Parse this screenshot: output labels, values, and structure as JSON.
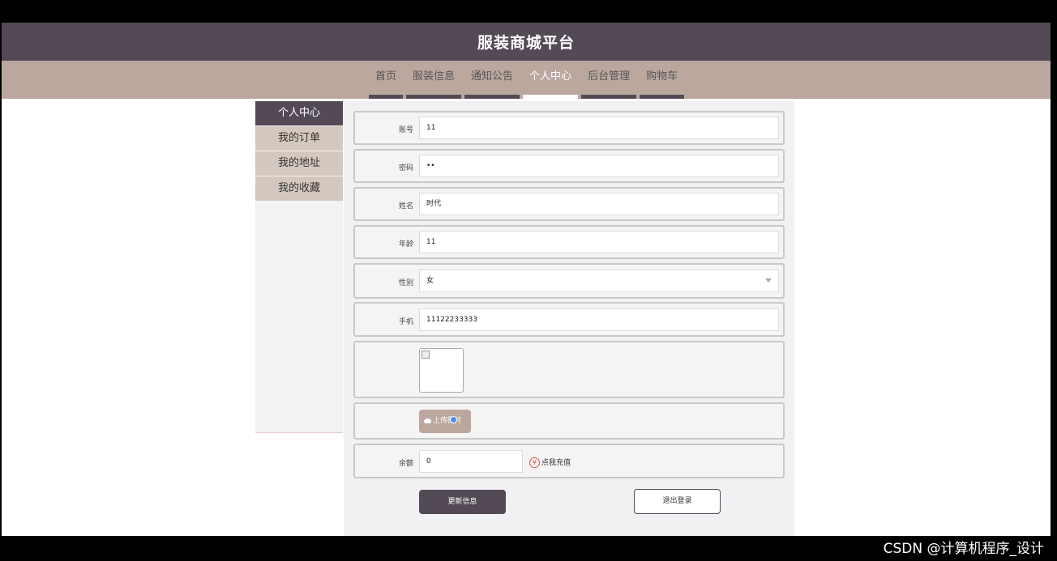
{
  "header": {
    "title": "服装商城平台"
  },
  "nav": {
    "items": [
      {
        "label": "首页"
      },
      {
        "label": "服装信息"
      },
      {
        "label": "通知公告"
      },
      {
        "label": "个人中心"
      },
      {
        "label": "后台管理"
      },
      {
        "label": "购物车"
      }
    ],
    "active_index": 3
  },
  "sidebar": {
    "items": [
      {
        "label": "个人中心"
      },
      {
        "label": "我的订单"
      },
      {
        "label": "我的地址"
      },
      {
        "label": "我的收藏"
      }
    ],
    "active_index": 0
  },
  "form": {
    "account": {
      "label": "账号",
      "value": "11"
    },
    "password": {
      "label": "密码",
      "value": "••"
    },
    "name": {
      "label": "姓名",
      "value": "时代"
    },
    "age": {
      "label": "年龄",
      "value": "11"
    },
    "gender": {
      "label": "性别",
      "value": "女"
    },
    "phone": {
      "label": "手机",
      "value": "11122233333"
    },
    "upload_label": "上传图片",
    "balance": {
      "label": "余额",
      "value": "0"
    },
    "recharge_label": "点我充值",
    "recharge_icon": "¥",
    "update_button": "更新信息",
    "logout_button": "退出登录"
  },
  "watermark": "CSDN @计算机程序_设计",
  "colors": {
    "primary": "#534a56",
    "nav_bg": "#bca79e",
    "sidebar_item_bg": "#d4c8be"
  }
}
